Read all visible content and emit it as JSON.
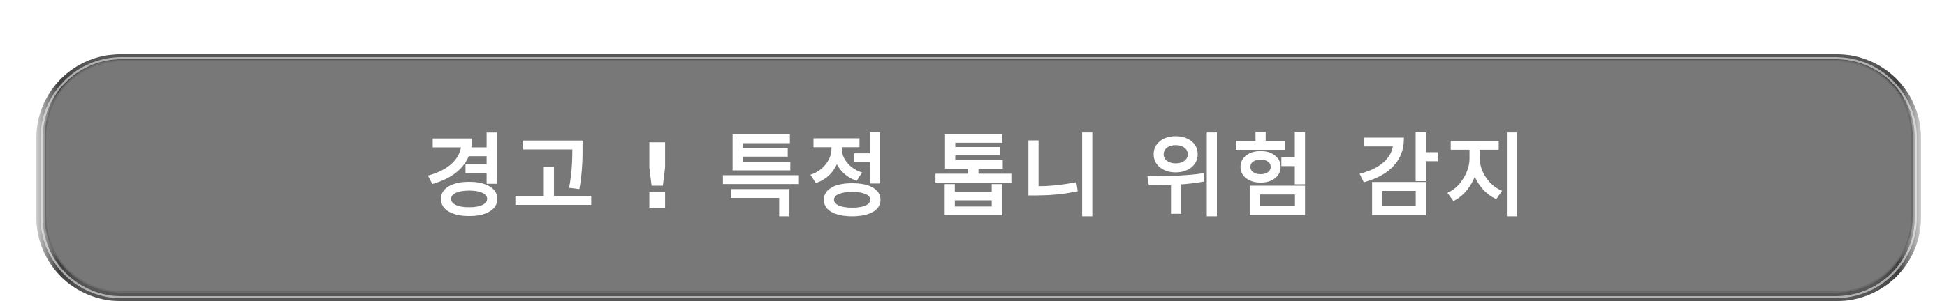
{
  "alert": {
    "message": "경고 ! 특정 톱니 위험 감지"
  },
  "colors": {
    "banner_fill": "#787878",
    "banner_border": "#565656",
    "text": "#ffffff",
    "background": "#ffffff"
  }
}
